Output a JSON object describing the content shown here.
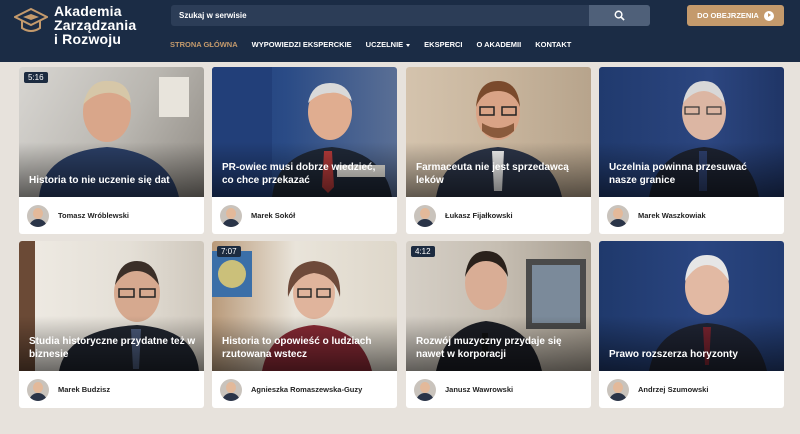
{
  "header": {
    "logo_lines": [
      "Akademia",
      "Zarządzania",
      "i Rozwoju"
    ],
    "search": {
      "placeholder": "Szukaj w serwisie"
    },
    "watch_button": "DO OBEJRZENIA",
    "nav": [
      "STRONA GŁÓWNA",
      "WYPOWIEDZI EKSPERCKIE",
      "UCZELNIE",
      "EKSPERCI",
      "O AKADEMII",
      "KONTAKT"
    ]
  },
  "colors": {
    "header_bg": "#1b2c45",
    "accent": "#c49a6c",
    "page_bg": "#e7e2dc"
  },
  "cards": [
    {
      "title": "Historia to nie uczenie się dat",
      "author": "Tomasz Wróblewski",
      "duration": "5:16"
    },
    {
      "title": "PR-owiec musi dobrze wiedzieć, co chce przekazać",
      "author": "Marek Sokół",
      "duration": ""
    },
    {
      "title": "Farmaceuta nie jest sprzedawcą leków",
      "author": "Łukasz Fijałkowski",
      "duration": ""
    },
    {
      "title": "Uczelnia powinna przesuwać nasze granice",
      "author": "Marek Waszkowiak",
      "duration": ""
    },
    {
      "title": "Studia historyczne przydatne też w biznesie",
      "author": "Marek Budzisz",
      "duration": ""
    },
    {
      "title": "Historia to opowieść o ludziach rzutowana wstecz",
      "author": "Agnieszka Romaszewska-Guzy",
      "duration": "7:07"
    },
    {
      "title": "Rozwój muzyczny przydaje się nawet w korporacji",
      "author": "Janusz Wawrowski",
      "duration": "4:12"
    },
    {
      "title": "Prawo rozszerza horyzonty",
      "author": "Andrzej Szumowski",
      "duration": ""
    }
  ]
}
